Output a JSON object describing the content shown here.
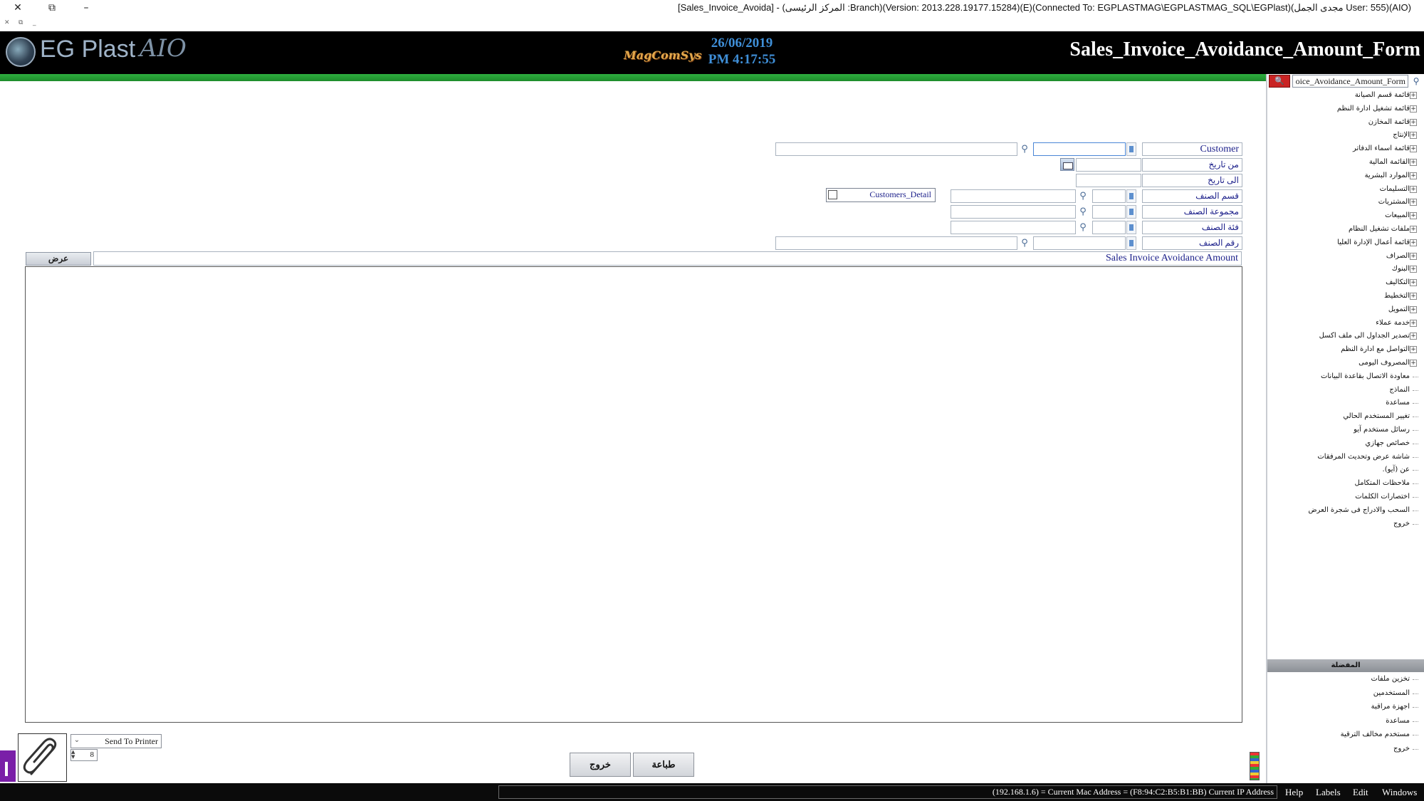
{
  "window": {
    "title": "[Sales_Invoice_Avoida] - (المركز الرئيسى :Branch)(Version: 2013.228.19177.15284)(E)(Connected To: EGPLASTMAG\\EGPLASTMAG_SQL\\EGPlast)(مجدى الجمل User: 555)(AIO)",
    "close_glyph": "✕",
    "restore_glyph": "⧉",
    "minimize_glyph": "–"
  },
  "header": {
    "logo_text": "EG Plast",
    "logo_script": "AIO",
    "brand_logo": "MagComSys",
    "date": "26/06/2019",
    "time": "PM 4:17:55",
    "form_title": "Sales_Invoice_Avoidance_Amount_Form"
  },
  "form": {
    "customer_label": "Customer",
    "from_date_label": "من تاريخ",
    "to_date_label": "الى تاريخ",
    "item_section_label": "قسم الصنف",
    "item_group_label": "مجموعة الصنف",
    "item_category_label": "فئة الصنف",
    "item_number_label": "رقم الصنف",
    "customers_detail_label": "Customers_Detail",
    "customers_detail_checked": false
  },
  "report": {
    "show_button": "عرض",
    "title": "Sales Invoice Avoidance Amount"
  },
  "bottom": {
    "printer_option": "Send To Printer",
    "copies": "8",
    "exit_button": "خروج",
    "print_button": "طباعة"
  },
  "sidebar": {
    "search_value": "oice_Avoidance_Amount_Form",
    "search_button_glyph": "🔍",
    "items": [
      {
        "label": "قائمة قسم الصيانة",
        "expandable": true
      },
      {
        "label": "قائمة تشغيل ادارة النظم",
        "expandable": true
      },
      {
        "label": "قائمة المخازن",
        "expandable": true
      },
      {
        "label": "الإنتاج",
        "expandable": true
      },
      {
        "label": "قائمة اسماء الدفاتر",
        "expandable": true
      },
      {
        "label": "القائمة المالية",
        "expandable": true
      },
      {
        "label": "الموارد البشرية",
        "expandable": true
      },
      {
        "label": "التسليمات",
        "expandable": true
      },
      {
        "label": "المشتريات",
        "expandable": true
      },
      {
        "label": "المبيعات",
        "expandable": true
      },
      {
        "label": "ملفات تشغيل النظام",
        "expandable": true
      },
      {
        "label": "قائمة أعمال الإدارة العليا",
        "expandable": true
      },
      {
        "label": "الصراف",
        "expandable": true
      },
      {
        "label": "البنوك",
        "expandable": true
      },
      {
        "label": "التكاليف",
        "expandable": true
      },
      {
        "label": "التخطيط",
        "expandable": true
      },
      {
        "label": "التمويل",
        "expandable": true
      },
      {
        "label": "خدمة عملاء",
        "expandable": true
      },
      {
        "label": "تصدير الجداول الى ملف اكسل",
        "expandable": true
      },
      {
        "label": "التواصل مع ادارة النظم",
        "expandable": true
      },
      {
        "label": "المصروف اليومى",
        "expandable": true
      },
      {
        "label": "معاودة الاتصال بقاعدة البيانات",
        "expandable": false
      },
      {
        "label": "النماذج",
        "expandable": false
      },
      {
        "label": "مساعدة",
        "expandable": false
      },
      {
        "label": "تغيير المستخدم الحالي",
        "expandable": false
      },
      {
        "label": "رسائل مستخدم آيو",
        "expandable": false
      },
      {
        "label": "خصائص جهازي",
        "expandable": false
      },
      {
        "label": "شاشة عرض وتحديث المرفقات",
        "expandable": false
      },
      {
        "label": "عن (آيو).",
        "expandable": false
      },
      {
        "label": "ملاحظات المتكامل",
        "expandable": false
      },
      {
        "label": "اختصارات الكلمات",
        "expandable": false
      },
      {
        "label": "السحب والادراج فى شجرة العرض",
        "expandable": false
      },
      {
        "label": "خروج",
        "expandable": false
      }
    ],
    "favorites_header": "المفضلة",
    "favorites": [
      {
        "label": "تخزين ملفات"
      },
      {
        "label": "المستخدمين"
      },
      {
        "label": "اجهزة مراقبة"
      },
      {
        "label": "مساعدة"
      },
      {
        "label": "مستخدم مخالف الترقية"
      },
      {
        "label": "خروج"
      }
    ]
  },
  "statusbar": {
    "text": "(192.168.1.6) = Current Mac Address = (F8:94:C2:B5:B1:BB) Current IP Address",
    "menu": [
      "Help",
      "Labels",
      "Edit",
      "Windows"
    ]
  },
  "colors": {
    "header_bg": "#000000",
    "green_bar": "#2fae3f",
    "label_text": "#1b1f8a",
    "date_time": "#3f8fd8",
    "search_button": "#c92424",
    "purple_tab": "#7a1fa8"
  }
}
